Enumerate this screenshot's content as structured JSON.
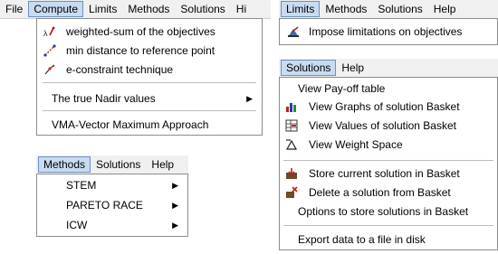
{
  "compute_window": {
    "menubar": [
      "File",
      "Compute",
      "Limits",
      "Methods",
      "Solutions",
      "Hi"
    ],
    "items": [
      {
        "label": "weighted-sum of the objectives",
        "icon": "weighted-sum-icon"
      },
      {
        "label": "min distance to reference point",
        "icon": "reference-point-icon"
      },
      {
        "label": "e-constraint technique",
        "icon": "e-constraint-icon"
      }
    ],
    "submenus": [
      {
        "label": "The true Nadir values"
      }
    ],
    "vma": "VMA-Vector Maximum Approach"
  },
  "methods_window": {
    "menubar": [
      "Methods",
      "Solutions",
      "Help"
    ],
    "items": [
      {
        "label": "STEM"
      },
      {
        "label": "PARETO RACE"
      },
      {
        "label": "ICW"
      }
    ]
  },
  "limits_window": {
    "menubar": [
      "Limits",
      "Methods",
      "Solutions",
      "Help"
    ],
    "items": [
      {
        "label": "Impose limitations on objectives",
        "icon": "limits-icon"
      }
    ]
  },
  "solutions_window": {
    "menubar": [
      "Solutions",
      "Help"
    ],
    "items": [
      {
        "label": "View Pay-off table"
      },
      {
        "label": "View Graphs of solution Basket",
        "icon": "graph-icon"
      },
      {
        "label": "View Values of solution Basket",
        "icon": "values-icon"
      },
      {
        "label": "View Weight Space",
        "icon": "weight-space-icon"
      },
      {
        "label": "Store current solution in Basket",
        "icon": "store-icon"
      },
      {
        "label": "Delete a solution from Basket",
        "icon": "delete-icon"
      },
      {
        "label": "Options to store solutions in Basket"
      },
      {
        "label": "Export data to a file in disk"
      }
    ]
  },
  "arrow_glyph": "▶"
}
